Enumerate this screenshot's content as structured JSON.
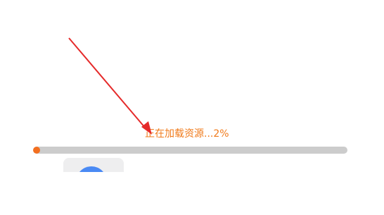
{
  "loading": {
    "status_text": "正在加载资源...2%",
    "progress_fraction": 0.02,
    "track_color": "#cccccc",
    "fill_color": "#f36f1f",
    "text_color": "#f07a1a"
  },
  "background_app": {
    "icon": "app-icon"
  },
  "annotation": {
    "icon": "arrow-icon",
    "color": "#e52a2a"
  }
}
